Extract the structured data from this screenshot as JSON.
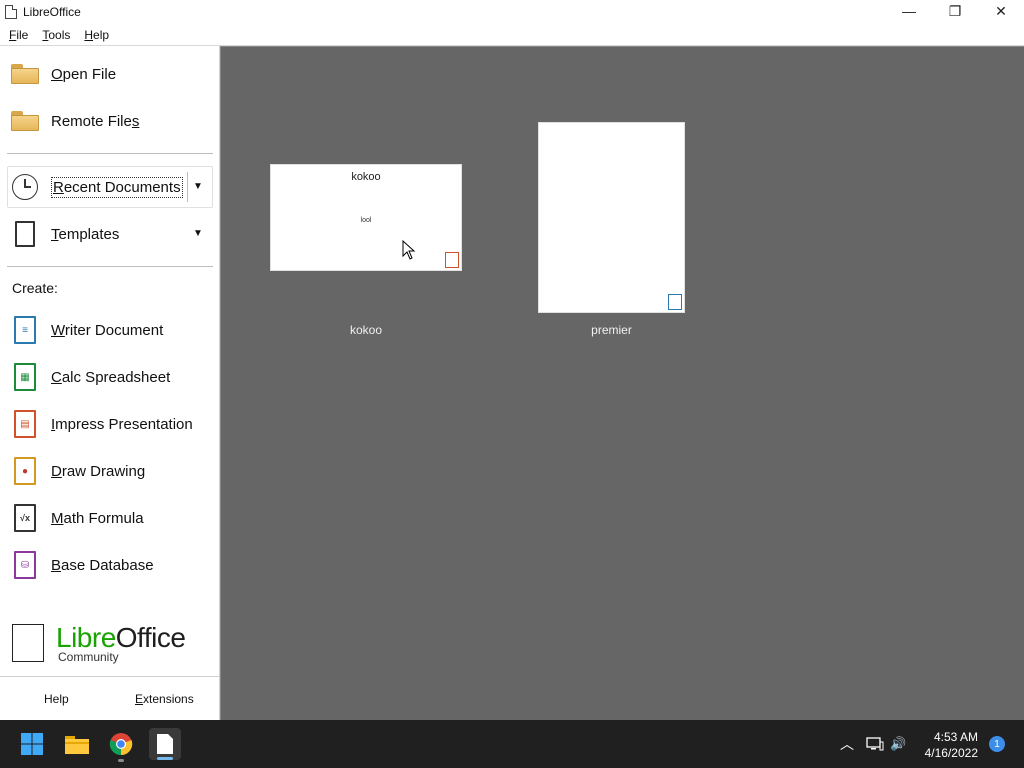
{
  "window": {
    "title": "LibreOffice",
    "minimize_glyph": "—",
    "maximize_glyph": "❐",
    "close_glyph": "✕"
  },
  "menu": [
    {
      "label_first": "F",
      "label_rest": "ile"
    },
    {
      "label_first": "T",
      "label_rest": "ools"
    },
    {
      "label_first": "H",
      "label_rest": "elp"
    }
  ],
  "sidebar": {
    "open_file": {
      "first": "O",
      "rest": "pen File",
      "icon": "folder-icon"
    },
    "remote_files": {
      "first": "Remote File",
      "ul": "s",
      "icon": "remote-folder-icon"
    },
    "recent_documents": {
      "first": "R",
      "rest": "ecent Documents",
      "icon": "clock-icon"
    },
    "templates": {
      "first": "T",
      "rest": "emplates",
      "icon": "templates-icon"
    },
    "create_label": "Create:",
    "create_items": [
      {
        "first": "W",
        "rest": "riter Document",
        "icon": "writer-icon",
        "color": "#2a7ab0"
      },
      {
        "first": "C",
        "rest": "alc Spreadsheet",
        "icon": "calc-icon",
        "color": "#1e8b3a"
      },
      {
        "first": "I",
        "rest": "mpress Presentation",
        "icon": "impress-icon",
        "color": "#d0512a"
      },
      {
        "first": "D",
        "rest": "raw Drawing",
        "icon": "draw-icon",
        "color": "#d29a1f"
      },
      {
        "first": "M",
        "rest": "ath Formula",
        "icon": "math-icon",
        "color": "#333333"
      },
      {
        "first": "B",
        "rest": "ase Database",
        "icon": "base-icon",
        "color": "#8a3a9a"
      }
    ],
    "logo": {
      "libre": "Libre",
      "office": "Office",
      "community": "Community"
    },
    "help": "Help",
    "extensions": {
      "first": "E",
      "rest": "xtensions"
    },
    "dropdown_glyph": "▼"
  },
  "documents": [
    {
      "name": "kokoo",
      "thumb_title": "kokoo",
      "thumb_sub": "lool",
      "badge": "impress-badge-icon",
      "badge_color": "#d0512a"
    },
    {
      "name": "premier",
      "thumb_title": "",
      "thumb_sub": "",
      "badge": "writer-badge-icon",
      "badge_color": "#2a7ab0"
    }
  ],
  "taskbar": {
    "time": "4:53 AM",
    "date": "4/16/2022",
    "notifications": "1",
    "chevron_glyph": "︿",
    "volume_glyph": "🔊"
  },
  "colors": {
    "libre_green": "#18a303",
    "main_bg": "#666666",
    "taskbar_bg": "#202020"
  }
}
